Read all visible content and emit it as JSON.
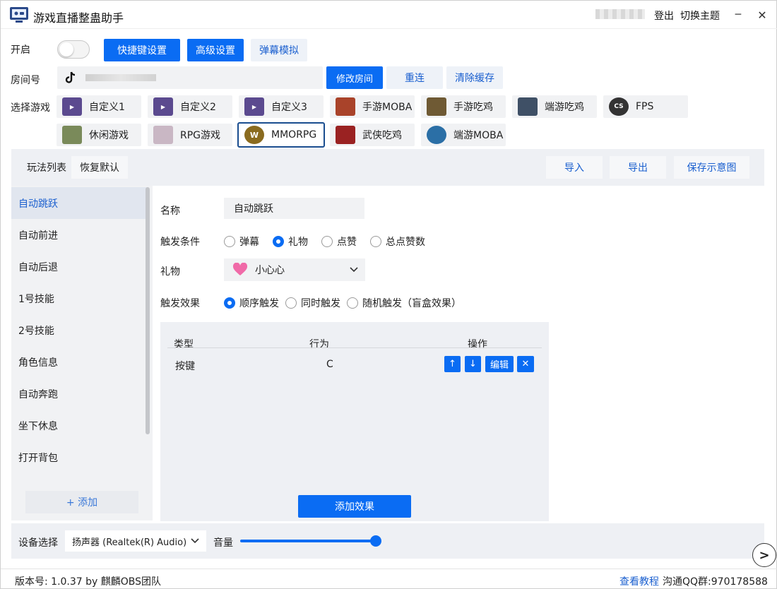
{
  "titlebar": {
    "title": "游戏直播整蛊助手",
    "login": "登出",
    "theme": "切换主题",
    "minimize": "─",
    "close": "✕"
  },
  "row1": {
    "label": "开启",
    "hotkey": "快捷键设置",
    "advanced": "高级设置",
    "danmaku_sim": "弹幕模拟"
  },
  "row2": {
    "label": "房间号",
    "room_value": "",
    "modify": "修改房间",
    "reconnect": "重连",
    "clear": "清除缓存"
  },
  "row3": {
    "label": "选择游戏",
    "games": [
      {
        "label": "自定义1",
        "icon": "start-game-icon",
        "color": "#5b4a8f"
      },
      {
        "label": "自定义2",
        "icon": "start-game-icon",
        "color": "#5b4a8f"
      },
      {
        "label": "自定义3",
        "icon": "start-game-icon",
        "color": "#5b4a8f"
      },
      {
        "label": "手游MOBA",
        "icon": "hero-icon",
        "color": "#a9432a"
      },
      {
        "label": "手游吃鸡",
        "icon": "soldier-icon",
        "color": "#6f5a34"
      },
      {
        "label": "端游吃鸡",
        "icon": "pubg-icon",
        "color": "#3f5066"
      },
      {
        "label": "FPS",
        "icon": "cs-icon",
        "color": "#333333"
      },
      {
        "label": "休闲游戏",
        "icon": "casual-icon",
        "color": "#7a8a5a"
      },
      {
        "label": "RPG游戏",
        "icon": "anime-icon",
        "color": "#c9b7c4"
      },
      {
        "label": "MMORPG",
        "icon": "wow-icon",
        "color": "#8a6b1f"
      },
      {
        "label": "武侠吃鸡",
        "icon": "wuxia-icon",
        "color": "#9a2222"
      },
      {
        "label": "端游MOBA",
        "icon": "lol-icon",
        "color": "#2b6fa6"
      }
    ]
  },
  "panel": {
    "list_title": "玩法列表",
    "reset": "恢复默认",
    "import": "导入",
    "export": "导出",
    "save_diagram": "保存示意图"
  },
  "plays": [
    "自动跳跃",
    "自动前进",
    "自动后退",
    "1号技能",
    "2号技能",
    "角色信息",
    "自动奔跑",
    "坐下休息",
    "打开背包"
  ],
  "add_play": "+ 添加",
  "detail": {
    "name_label": "名称",
    "name_value": "自动跳跃",
    "trigger_label": "触发条件",
    "triggers": [
      "弹幕",
      "礼物",
      "点赞",
      "总点赞数"
    ],
    "gift_label": "礼物",
    "gift_value": "小心心",
    "effect_label": "触发效果",
    "effects": [
      "顺序触发",
      "同时触发",
      "随机触发（盲盒效果）"
    ]
  },
  "table": {
    "headers": [
      "类型",
      "行为",
      "操作"
    ],
    "rows": [
      {
        "type": "按键",
        "action": "C"
      }
    ],
    "up": "↑",
    "down": "↓",
    "edit": "编辑",
    "delete": "✕",
    "add_effect": "添加效果"
  },
  "device": {
    "label": "设备选择",
    "value": "扬声器 (Realtek(R) Audio)",
    "volume_label": "音量",
    "volume": 1.0,
    "next": ">"
  },
  "status": {
    "version": "版本号: 1.0.37 by 麒麟OBS团队",
    "tutorial": "查看教程",
    "qq": "沟通QQ群:970178588"
  }
}
